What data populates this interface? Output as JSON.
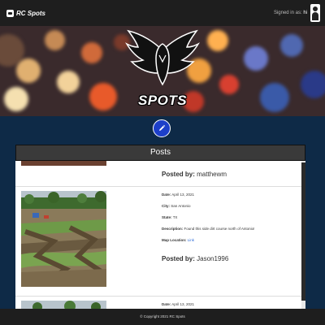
{
  "nav": {
    "brand": "RC Spots",
    "signed_in_label": "Signed in as:",
    "signed_in_user": "hi"
  },
  "hero": {
    "title": "SPOTS"
  },
  "posts": {
    "header": "Posts",
    "items": [
      {
        "posted_by_label": "Posted by:",
        "posted_by": "matthewm"
      },
      {
        "date_label": "Date:",
        "date": "April 13, 2021",
        "city_label": "City:",
        "city": "San Antonio",
        "state_label": "State:",
        "state": "TX",
        "description_label": "Description:",
        "description": "Found this side dirt course north of Antonio!",
        "map_label": "Map Location:",
        "map_link": "Link",
        "posted_by_label": "Posted by:",
        "posted_by": "Jason1996"
      },
      {
        "date_label": "Date:",
        "date": "April 13, 2021"
      }
    ]
  },
  "footer": {
    "text": "© Copyright 2021 RC Spots"
  },
  "icons": {
    "add": "pencil-icon",
    "user": "user-icon",
    "brand": "rc-car-icon"
  },
  "colors": {
    "navbar": "#1e1e1e",
    "page_bg": "#0e2a47",
    "add_button": "#1d3fc9",
    "link": "#2a6ad8"
  }
}
